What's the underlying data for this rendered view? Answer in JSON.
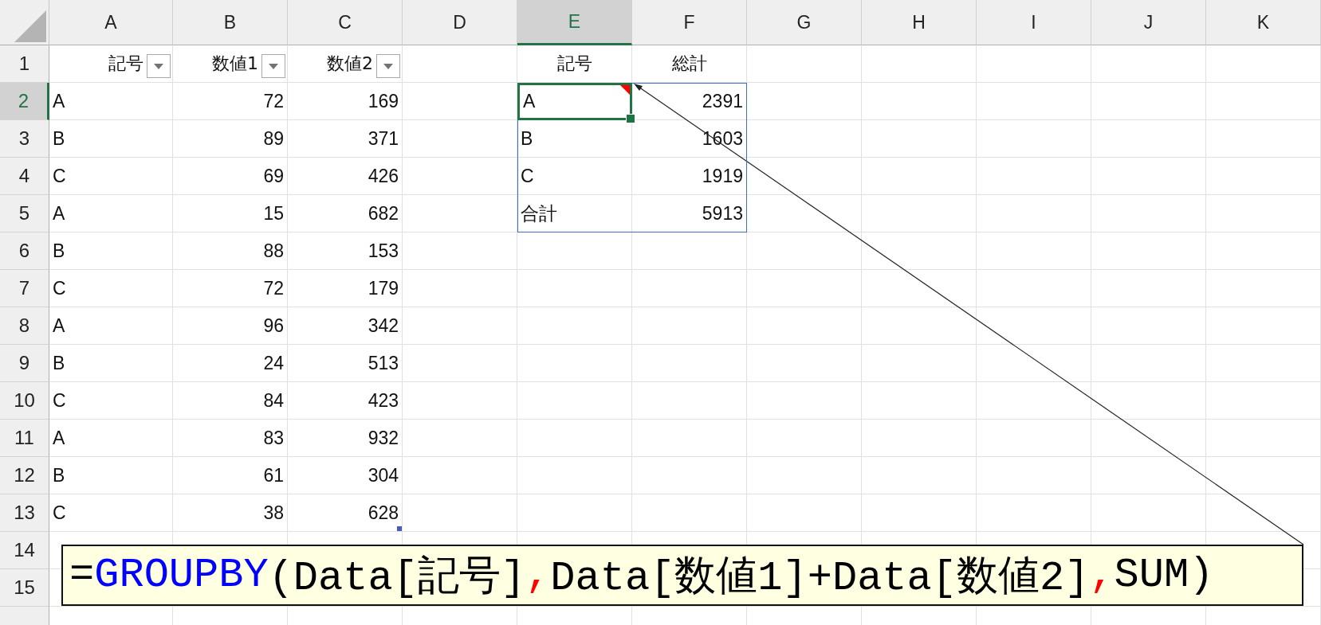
{
  "column_headers": [
    {
      "label": "A",
      "selected": false
    },
    {
      "label": "B",
      "selected": false
    },
    {
      "label": "C",
      "selected": false
    },
    {
      "label": "D",
      "selected": false
    },
    {
      "label": "E",
      "selected": true
    },
    {
      "label": "F",
      "selected": false
    },
    {
      "label": "G",
      "selected": false
    },
    {
      "label": "H",
      "selected": false
    },
    {
      "label": "I",
      "selected": false
    },
    {
      "label": "J",
      "selected": false
    },
    {
      "label": "K",
      "selected": false
    }
  ],
  "row_headers": [
    {
      "label": "1",
      "selected": false
    },
    {
      "label": "2",
      "selected": true
    },
    {
      "label": "3",
      "selected": false
    },
    {
      "label": "4",
      "selected": false
    },
    {
      "label": "5",
      "selected": false
    },
    {
      "label": "6",
      "selected": false
    },
    {
      "label": "7",
      "selected": false
    },
    {
      "label": "8",
      "selected": false
    },
    {
      "label": "9",
      "selected": false
    },
    {
      "label": "10",
      "selected": false
    },
    {
      "label": "11",
      "selected": false
    },
    {
      "label": "12",
      "selected": false
    },
    {
      "label": "13",
      "selected": false
    },
    {
      "label": "14",
      "selected": false
    },
    {
      "label": "15",
      "selected": false
    }
  ],
  "data_table": {
    "columns": [
      "記号",
      "数値1",
      "数値2"
    ],
    "rows": [
      [
        "A",
        "72",
        "169"
      ],
      [
        "B",
        "89",
        "371"
      ],
      [
        "C",
        "69",
        "426"
      ],
      [
        "A",
        "15",
        "682"
      ],
      [
        "B",
        "88",
        "153"
      ],
      [
        "C",
        "72",
        "179"
      ],
      [
        "A",
        "96",
        "342"
      ],
      [
        "B",
        "24",
        "513"
      ],
      [
        "C",
        "84",
        "423"
      ],
      [
        "A",
        "83",
        "932"
      ],
      [
        "B",
        "61",
        "304"
      ],
      [
        "C",
        "38",
        "628"
      ]
    ]
  },
  "result_table": {
    "columns": [
      "記号",
      "総計"
    ],
    "rows": [
      {
        "label": "A",
        "total": "2391",
        "selected": true,
        "has_comment": true
      },
      {
        "label": "B",
        "total": "1603",
        "selected": false,
        "has_comment": false
      },
      {
        "label": "C",
        "total": "1919",
        "selected": false,
        "has_comment": false
      },
      {
        "label": "合計",
        "total": "5913",
        "selected": false,
        "has_comment": false
      }
    ]
  },
  "formula_callout": {
    "segments": [
      {
        "text": "=",
        "kind": "text"
      },
      {
        "text": "GROUPBY",
        "kind": "function"
      },
      {
        "text": "(Data[記号]",
        "kind": "text"
      },
      {
        "text": ",",
        "kind": "separator"
      },
      {
        "text": "Data[数値1]+Data[数値2]",
        "kind": "text"
      },
      {
        "text": ",",
        "kind": "separator"
      },
      {
        "text": "SUM)",
        "kind": "text"
      }
    ]
  }
}
